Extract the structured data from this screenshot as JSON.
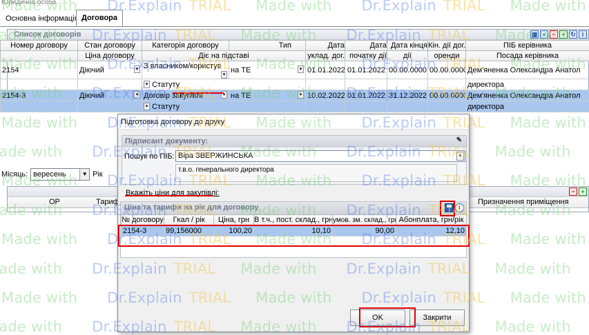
{
  "window": {
    "title": "Юридична особа"
  },
  "tabs": [
    {
      "label": "Основна інформація"
    },
    {
      "label": "Договора"
    }
  ],
  "contracts": {
    "title": "Список договорів",
    "headers_top": [
      "Номер договору",
      "Стан договору",
      "Категорія договору",
      "Тип",
      "Дата",
      "Дата",
      "Дата кінця",
      "Кін. дії дог.",
      "ПІБ керівника"
    ],
    "headers_bottom": [
      "",
      "Ціна договору",
      "Діє на підставі",
      "",
      "уклад. дог.",
      "початку дії",
      "дії",
      "оренди",
      "Посада керівника"
    ],
    "rows": [
      {
        "number": "2154",
        "status": "Діючий",
        "category": "З власником/користув",
        "type": "на ТЕ",
        "date_signed": "01.01.2022",
        "date_start": "01.01.2022",
        "date_end": "00.00.0000",
        "lease_end": "00.00.0000",
        "manager": "Дем'яненка Олександра Анатол",
        "basis": "Статуту",
        "manager_position": "директора"
      },
      {
        "number": "2154-3",
        "status": "Діючий",
        "category": "Договір закупівлі",
        "type": "на ТЕ",
        "date_signed": "10.02.2022",
        "date_start": "01.01.2022",
        "date_end": "31.12.2022",
        "lease_end": "00.00.0000",
        "manager": "Дем'яненка Олександра Анатол",
        "basis": "Статуту",
        "manager_position": "директора"
      }
    ]
  },
  "month": {
    "label": "Місяць:",
    "value": "вересень",
    "year_label": "Рік"
  },
  "lower": {
    "col_op": "ОР",
    "col_tariff": "Тариф",
    "col_purpose": "Призначення приміщення"
  },
  "modal": {
    "title": "Підготовка договору до друку",
    "signer_section": "Підписант документу:",
    "search_label": "Пошук по ПІБ:",
    "search_value": "Віра ЗВЕРЖИНСЬКА",
    "position_value": "т.в.о. генерального директора",
    "prices_label": "Вкажіть ціни для закупівлі:",
    "prices_section": "Ціна та тарифи на рік для договору",
    "price_headers": [
      "№ договору",
      "Гкал / рік",
      "Ціна, грн",
      "В т.ч., пост. склад., грн",
      "умов. зм. склад., грн",
      "Абонплата, грн/рік"
    ],
    "price_rows": [
      {
        "contract": "2154-3",
        "gcal": "99,156000",
        "price": "100,20",
        "fixed": "10,10",
        "variable": "90,00",
        "fee": "12,10"
      }
    ],
    "ok_label": "OK",
    "close_label": "Закрити"
  },
  "watermark": {
    "made": "Made",
    "with": "with",
    "brand": "Dr.Explain",
    "trial": "TRIAL"
  }
}
